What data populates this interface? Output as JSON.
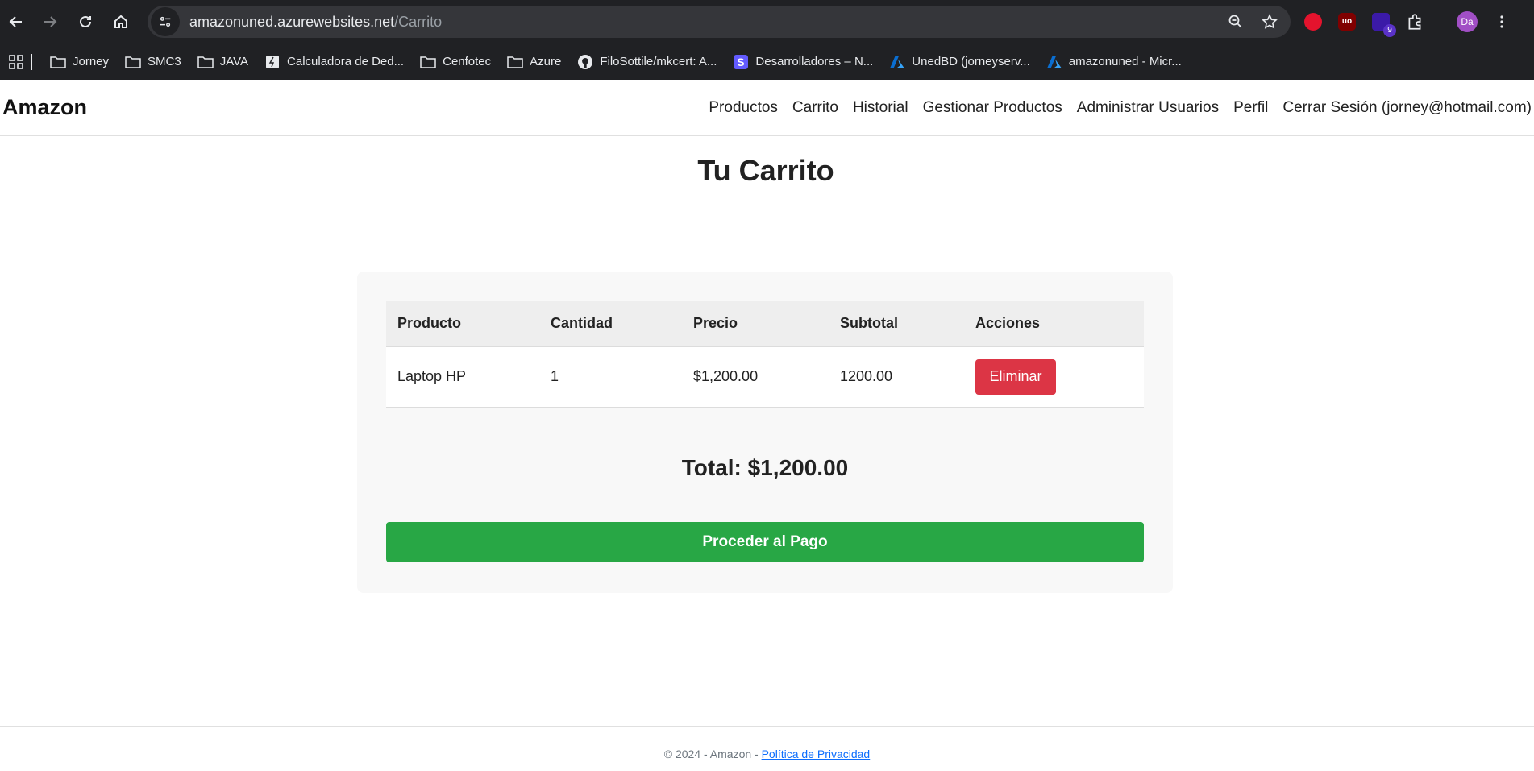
{
  "browser": {
    "url_host": "amazonuned.azurewebsites.net",
    "url_path": "/Carrito",
    "extension_badge": "9",
    "profile_initials": "Da",
    "bookmarks": [
      {
        "label": "Jorney",
        "icon": "folder-icon"
      },
      {
        "label": "SMC3",
        "icon": "folder-icon"
      },
      {
        "label": "JAVA",
        "icon": "folder-icon"
      },
      {
        "label": "Calculadora de Ded...",
        "icon": "calculator-icon"
      },
      {
        "label": "Cenfotec",
        "icon": "folder-icon"
      },
      {
        "label": "Azure",
        "icon": "folder-icon"
      },
      {
        "label": "FiloSottile/mkcert: A...",
        "icon": "github-icon"
      },
      {
        "label": "Desarrolladores – N...",
        "icon": "stripe-icon"
      },
      {
        "label": "UnedBD (jorneyserv...",
        "icon": "azure-icon"
      },
      {
        "label": "amazonuned - Micr...",
        "icon": "azure-icon"
      }
    ]
  },
  "header": {
    "brand": "Amazon",
    "nav": [
      "Productos",
      "Carrito",
      "Historial",
      "Gestionar Productos",
      "Administrar Usuarios",
      "Perfil",
      "Cerrar Sesión (jorney@hotmail.com)"
    ]
  },
  "page": {
    "title": "Tu Carrito",
    "table": {
      "headers": [
        "Producto",
        "Cantidad",
        "Precio",
        "Subtotal",
        "Acciones"
      ],
      "rows": [
        {
          "product": "Laptop HP",
          "quantity": "1",
          "price": "$1,200.00",
          "subtotal": "1200.00",
          "action": "Eliminar"
        }
      ]
    },
    "total": "Total: $1,200.00",
    "pay_button": "Proceder al Pago"
  },
  "footer": {
    "text": "© 2024 - Amazon - ",
    "link": "Política de Privacidad"
  },
  "colors": {
    "delete": "#dc3545",
    "pay": "#28a745",
    "link": "#0d6efd"
  }
}
